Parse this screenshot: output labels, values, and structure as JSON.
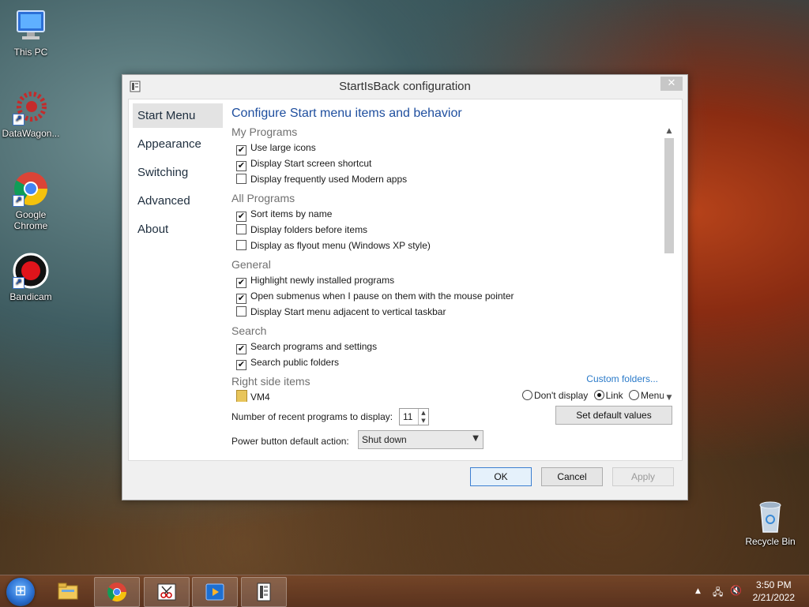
{
  "desktop": {
    "icons": [
      {
        "label": "This PC"
      },
      {
        "label": "DataWagon..."
      },
      {
        "label": "Google Chrome"
      },
      {
        "label": "Bandicam"
      },
      {
        "label": "Recycle Bin"
      }
    ]
  },
  "dialog": {
    "title": "StartIsBack configuration",
    "close_glyph": "✕",
    "nav": [
      "Start Menu",
      "Appearance",
      "Switching",
      "Advanced",
      "About"
    ],
    "heading": "Configure Start menu items and behavior",
    "sections": {
      "my_programs": {
        "title": "My Programs",
        "options": [
          {
            "label": "Use large icons",
            "checked": true
          },
          {
            "label": "Display Start screen shortcut",
            "checked": true
          },
          {
            "label": "Display frequently used Modern apps",
            "checked": false
          }
        ]
      },
      "all_programs": {
        "title": "All Programs",
        "options": [
          {
            "label": "Sort items by name",
            "checked": true
          },
          {
            "label": "Display folders before items",
            "checked": false
          },
          {
            "label": "Display as flyout menu (Windows XP style)",
            "checked": false
          }
        ]
      },
      "general": {
        "title": "General",
        "options": [
          {
            "label": "Highlight newly installed programs",
            "checked": true
          },
          {
            "label": "Open submenus when I pause on them with the mouse pointer",
            "checked": true
          },
          {
            "label": "Display Start menu adjacent to vertical taskbar",
            "checked": false
          }
        ]
      },
      "search": {
        "title": "Search",
        "options": [
          {
            "label": "Search programs and settings",
            "checked": true
          },
          {
            "label": "Search public folders",
            "checked": true
          }
        ]
      },
      "right_side": {
        "title": "Right side items",
        "custom_link": "Custom folders...",
        "item_label": "VM4",
        "radio": {
          "dont_display": "Don't display",
          "link": "Link",
          "menu": "Menu",
          "selected": "Link"
        }
      }
    },
    "recent_label": "Number of recent programs to display:",
    "recent_value": "11",
    "set_default_label": "Set default values",
    "power_label": "Power button default action:",
    "power_value": "Shut down",
    "buttons": {
      "ok": "OK",
      "cancel": "Cancel",
      "apply": "Apply"
    }
  },
  "taskbar": {
    "clock_time": "3:50 PM",
    "clock_date": "2/21/2022"
  }
}
